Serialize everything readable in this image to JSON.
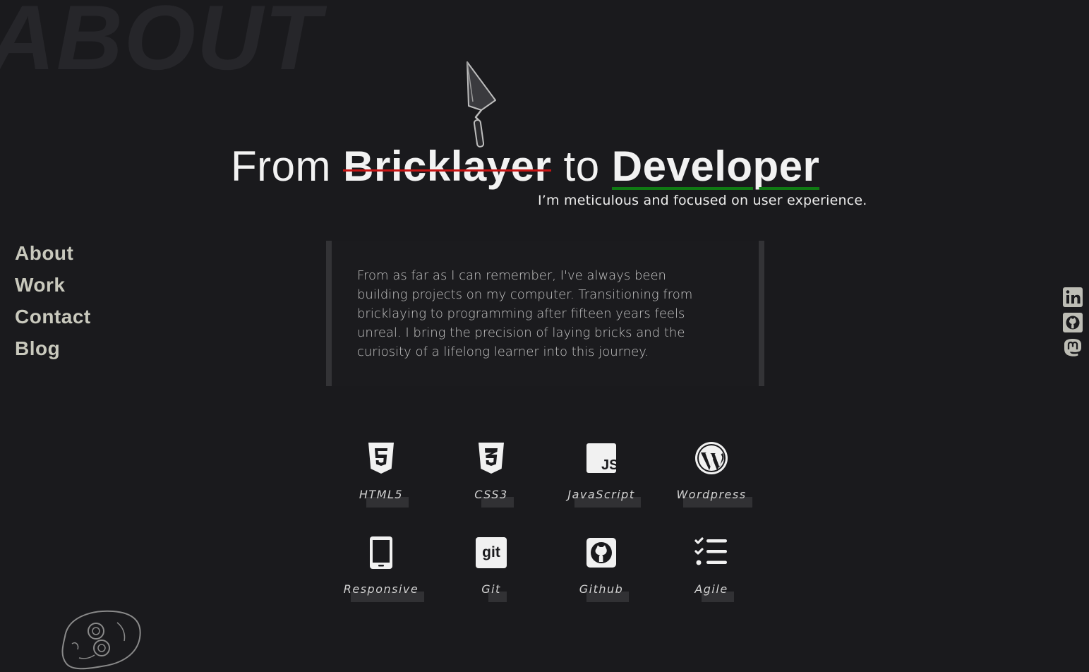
{
  "background_word": "ABOUT",
  "hero": {
    "from": "From",
    "struck": "Bricklayer",
    "to": "to",
    "highlight": "Developer",
    "tagline": "I’m meticulous and focused on user experience."
  },
  "nav": {
    "items": [
      "About",
      "Work",
      "Contact",
      "Blog"
    ]
  },
  "bio": {
    "text": "From as far as I can remember, I've always been building projects on my computer. Transitioning from bricklaying to programming after fifteen years feels unreal. I bring the precision of laying bricks and the curiosity of a lifelong learner into this journey."
  },
  "skills": [
    {
      "label": "HTML5",
      "icon": "html5-icon"
    },
    {
      "label": "CSS3",
      "icon": "css3-icon"
    },
    {
      "label": "JavaScript",
      "icon": "javascript-icon"
    },
    {
      "label": "Wordpress",
      "icon": "wordpress-icon"
    },
    {
      "label": "Responsive",
      "icon": "mobile-icon"
    },
    {
      "label": "Git",
      "icon": "git-icon"
    },
    {
      "label": "Github",
      "icon": "github-icon"
    },
    {
      "label": "Agile",
      "icon": "checklist-icon"
    }
  ],
  "socials": [
    {
      "name": "linkedin-icon"
    },
    {
      "name": "github-icon"
    },
    {
      "name": "mastodon-icon"
    }
  ],
  "colors": {
    "background": "#1a1a1d",
    "strike": "#c81414",
    "underline": "#0f7a13",
    "nav": "#c9c9bd"
  }
}
